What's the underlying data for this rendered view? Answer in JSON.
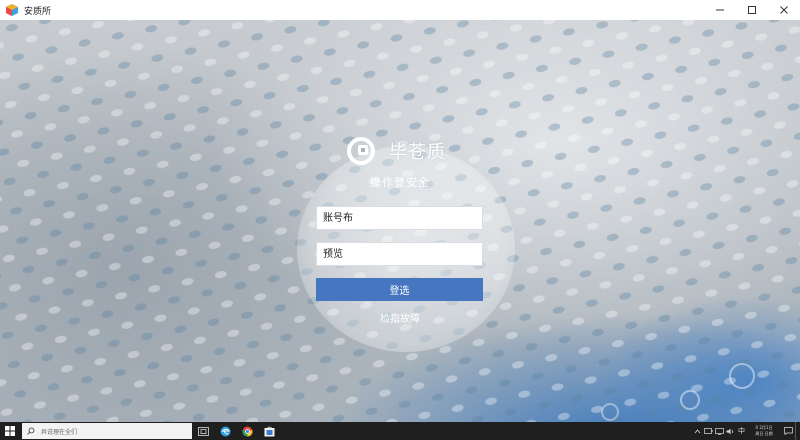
{
  "window": {
    "title": "安质所",
    "minimize_icon": "minimize-icon",
    "maximize_icon": "maximize-icon",
    "close_icon": "close-icon"
  },
  "login": {
    "brand_name": "毕苍质",
    "subtitle": "操作登安全",
    "username_placeholder": "账号布",
    "password_placeholder": "预览",
    "login_button": "登选",
    "forgot_link": "检指故障"
  },
  "taskbar": {
    "search_placeholder": "异说理在全们",
    "apps": [
      "task-view-icon",
      "edge-icon",
      "chrome-icon",
      "store-icon"
    ],
    "tray_icons": [
      "up-arrow-icon",
      "battery-icon",
      "network-icon",
      "volume-icon",
      "ime-icon"
    ],
    "ime_label": "中",
    "clock_time": "0 2月1日",
    "clock_date": "周日 日期"
  },
  "colors": {
    "accent": "#4676bf",
    "titlebar": "#ffffff",
    "taskbar": "#1f1f1f"
  }
}
